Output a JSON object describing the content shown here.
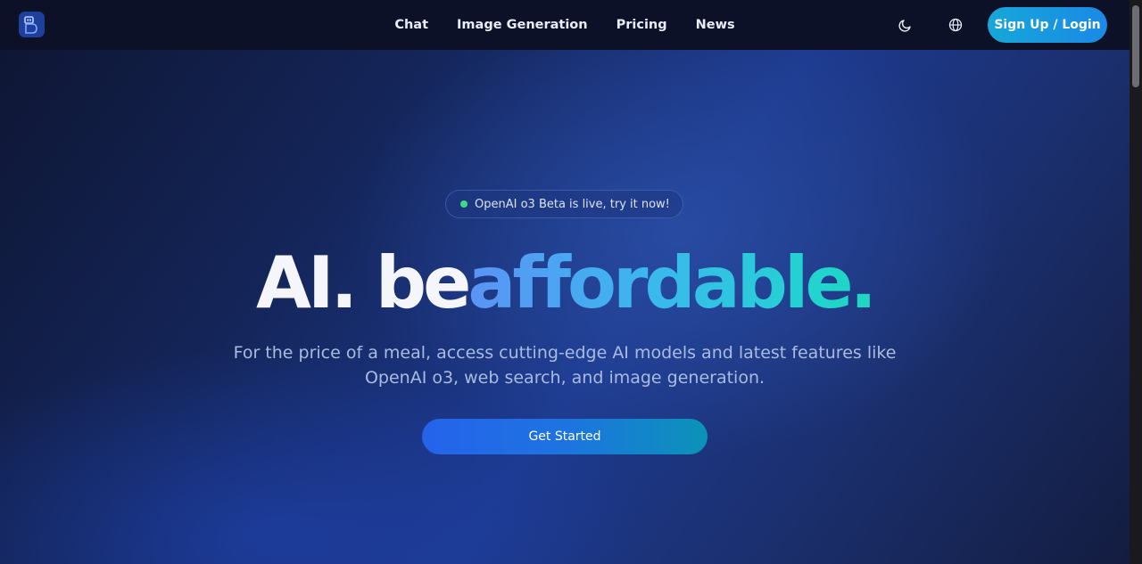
{
  "nav": {
    "items": [
      {
        "label": "Chat"
      },
      {
        "label": "Image Generation"
      },
      {
        "label": "Pricing"
      },
      {
        "label": "News"
      }
    ],
    "signup_label": "Sign Up / Login",
    "icons": {
      "logo": "logo-icon",
      "theme": "moon-icon",
      "language": "globe-icon"
    }
  },
  "hero": {
    "badge": "OpenAI o3 Beta is live, try it now!",
    "title_plain": "AI. be",
    "title_accent": "affordable.",
    "subtitle_line1": "For the price of a meal, access cutting-edge AI models and latest features like",
    "subtitle_line2": "OpenAI o3, web search, and image generation.",
    "cta_label": "Get Started"
  },
  "colors": {
    "background": "#142559",
    "topbar": "#0d1128",
    "accent_start": "#5b93f5",
    "accent_end": "#1ed6c0",
    "badge_dot": "#3ddc84",
    "signup_button": "#16a7d8"
  }
}
